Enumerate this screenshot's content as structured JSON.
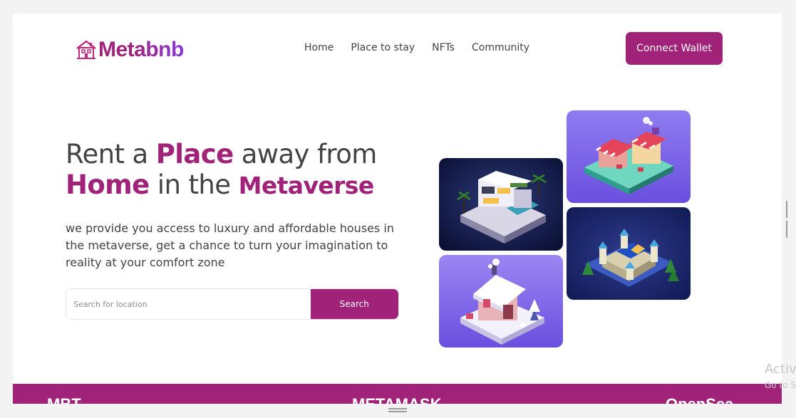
{
  "brand": {
    "name": "Metabnb",
    "icon": "house-logo-icon",
    "color": "#a02279"
  },
  "nav": {
    "items": [
      {
        "label": "Home"
      },
      {
        "label": "Place to stay"
      },
      {
        "label": "NFTs"
      },
      {
        "label": "Community"
      }
    ]
  },
  "header": {
    "connect_label": "Connect Wallet"
  },
  "hero": {
    "headline": {
      "p1": "Rent a ",
      "h1": "Place",
      "p2": " away from ",
      "h2": "Home",
      "p3": " in the ",
      "h3": "Metaverse"
    },
    "subtext": "we provide you access to luxury and affordable houses in the metaverse, get a chance to turn your imagination to reality at your comfort zone"
  },
  "search": {
    "placeholder": "Search for location",
    "value": "",
    "button_label": "Search"
  },
  "cards": [
    {
      "name": "modern-villa-image"
    },
    {
      "name": "market-stall-image"
    },
    {
      "name": "castle-image"
    },
    {
      "name": "snow-cabin-image"
    }
  ],
  "partners": [
    {
      "label": "MBT.."
    },
    {
      "label": "METAMASK"
    },
    {
      "label": "OpenSea"
    }
  ],
  "os_watermark": {
    "title": "Activ",
    "subtitle": "Go to S"
  },
  "colors": {
    "accent": "#a02279",
    "text": "#434343",
    "background": "#ffffff"
  }
}
